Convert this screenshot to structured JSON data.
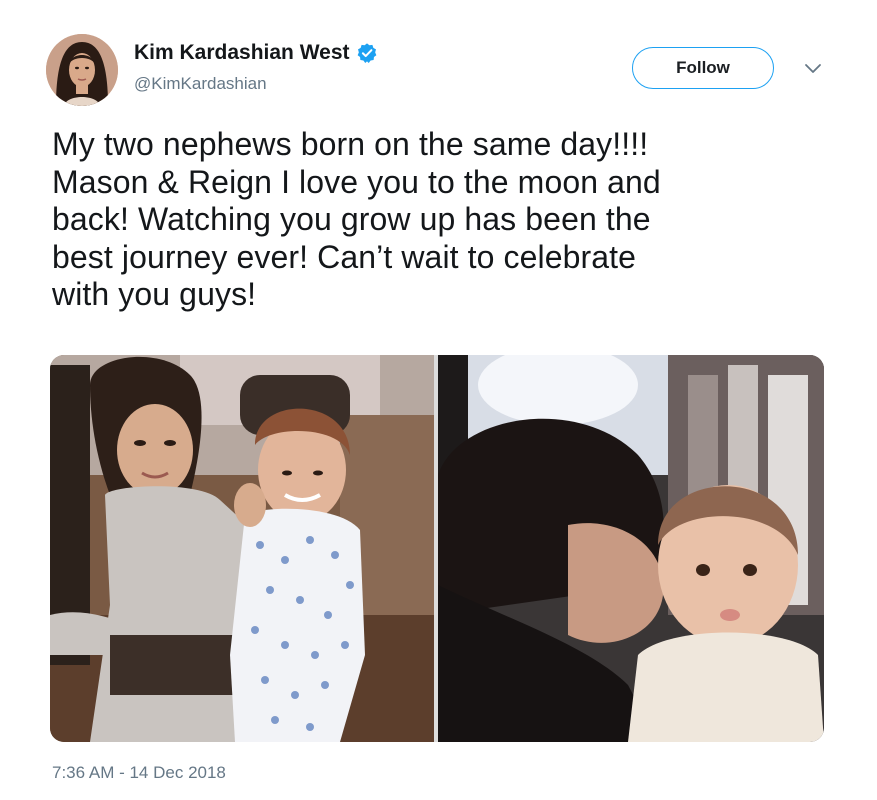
{
  "author": {
    "display_name": "Kim Kardashian West",
    "handle": "@KimKardashian",
    "verified": true
  },
  "actions": {
    "follow_label": "Follow"
  },
  "tweet": {
    "text_lines": [
      "My two nephews born on the same day!!!!",
      "Mason & Reign I love you to the moon and",
      "back! Watching you grow up has been the",
      "best journey ever! Can’t wait to celebrate",
      "with you guys!"
    ],
    "timestamp": "7:36 AM - 14 Dec 2018"
  },
  "icons": {
    "verified": "verified-badge-icon",
    "caret": "chevron-down-icon"
  },
  "colors": {
    "accent": "#1da1f2",
    "text": "#14171a",
    "secondary_text": "#657786"
  }
}
